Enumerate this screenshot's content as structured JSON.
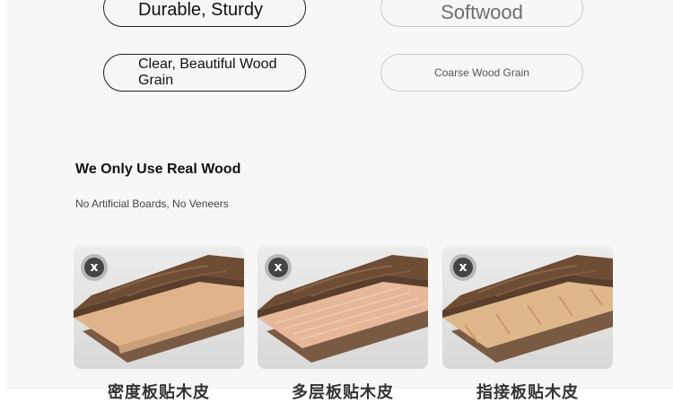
{
  "features": {
    "durable": "Durable, Sturdy",
    "softwood": "Softwood",
    "clear_grain": "Clear, Beautiful Wood Grain",
    "coarse_grain": "Coarse Wood Grain"
  },
  "section": {
    "heading": "We Only Use Real Wood",
    "subheading": "No Artificial Boards, No Veneers"
  },
  "cards": [
    {
      "badge": "x",
      "caption": "密度板贴木皮"
    },
    {
      "badge": "x",
      "caption": "多层板贴木皮"
    },
    {
      "badge": "x",
      "caption": "指接板贴木皮"
    }
  ],
  "colors": {
    "panel_bg": "#f7f7f7",
    "walnut": "#6e4d34",
    "badge": "#444444"
  }
}
